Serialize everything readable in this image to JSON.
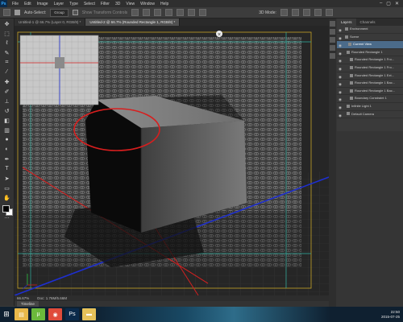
{
  "menubar": {
    "logo": "Ps",
    "items": [
      "File",
      "Edit",
      "Image",
      "Layer",
      "Type",
      "Select",
      "Filter",
      "3D",
      "View",
      "Window",
      "Help"
    ],
    "window_controls": [
      "–",
      "▢",
      "✕"
    ]
  },
  "options_bar": {
    "auto_select_label": "Auto-Select:",
    "auto_select_value": "Group",
    "show_transform_label": "Show Transform Controls",
    "mode_label": "3D Mode:"
  },
  "tabs": [
    {
      "label": "Untitled-1 @ 66.7% (Layer 0, RGB/8) *",
      "active": false
    },
    {
      "label": "Untitled-2 @ 66.7% (Rounded Rectangle 1, RGB/8) *",
      "active": true
    }
  ],
  "status": {
    "zoom": "66.67%",
    "doc": "Doc: 1.76M/5.66M"
  },
  "timeline_label": "Timeline",
  "panel": {
    "tabs": [
      "Layers",
      "Channels"
    ],
    "rows": [
      {
        "label": "Environment",
        "indent": 2,
        "selected": false
      },
      {
        "label": "Scene",
        "indent": 2,
        "selected": false
      },
      {
        "label": "Current View",
        "indent": 6,
        "selected": true
      },
      {
        "label": "Rounded Rectangle 1",
        "indent": 4,
        "selected": false
      },
      {
        "label": "Rounded Rectangle 1 Fro...",
        "indent": 8,
        "selected": false
      },
      {
        "label": "Rounded Rectangle 1 Fro...",
        "indent": 8,
        "selected": false
      },
      {
        "label": "Rounded Rectangle 1 Ext...",
        "indent": 8,
        "selected": false
      },
      {
        "label": "Rounded Rectangle 1 Bac...",
        "indent": 8,
        "selected": false
      },
      {
        "label": "Rounded Rectangle 1 Bac...",
        "indent": 8,
        "selected": false
      },
      {
        "label": "Boundary Constraint 1",
        "indent": 8,
        "selected": false
      },
      {
        "label": "Infinite Light 1",
        "indent": 4,
        "selected": false
      },
      {
        "label": "Default Camera",
        "indent": 4,
        "selected": false
      }
    ]
  },
  "taskbar": {
    "apps": [
      {
        "icon": "file-explorer-icon",
        "glyph": "▤",
        "color": "#e8b84a"
      },
      {
        "icon": "utorrent-icon",
        "glyph": "µ",
        "color": "#6bb93b"
      },
      {
        "icon": "chrome-icon",
        "glyph": "◉",
        "color": "#e04b3a"
      },
      {
        "icon": "photoshop-icon",
        "glyph": "Ps",
        "color": "#0b2a4a"
      },
      {
        "icon": "folder-icon",
        "glyph": "▬",
        "color": "#e6c25a"
      }
    ],
    "time": "22:50",
    "date": "2015-07-25"
  },
  "colors": {
    "guide": "#2fb0a0",
    "axis_x": "#d02020",
    "axis_z": "#1e2fd0",
    "highlight": "#d81e1e"
  }
}
